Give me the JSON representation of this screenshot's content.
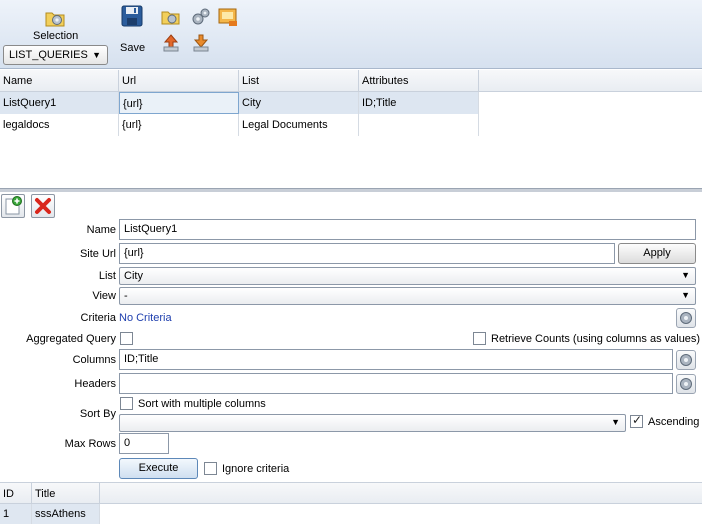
{
  "toolbar": {
    "selection_label": "Selection",
    "selection_value": "LIST_QUERIES",
    "save_label": "Save",
    "icons": [
      "settings-folder-icon",
      "save-icon",
      "folder-gear-icon",
      "gears-icon",
      "image-export-icon",
      "upload-icon",
      "download-icon"
    ]
  },
  "queries_grid": {
    "columns": [
      "Name",
      "Url",
      "List",
      "Attributes"
    ],
    "rows": [
      {
        "name": "ListQuery1",
        "url": "{url}",
        "list": "City",
        "attributes": "ID;Title"
      },
      {
        "name": "legaldocs",
        "url": "{url}",
        "list": "Legal Documents",
        "attributes": ""
      }
    ]
  },
  "form": {
    "name_label": "Name",
    "name_value": "ListQuery1",
    "site_url_label": "Site Url",
    "site_url_value": "{url}",
    "apply_label": "Apply",
    "list_label": "List",
    "list_value": "City",
    "view_label": "View",
    "view_value": "-",
    "criteria_label": "Criteria",
    "criteria_value": "No Criteria",
    "aggregated_label": "Aggregated Query",
    "aggregated_checked": false,
    "retrieve_counts_label": "Retrieve Counts (using columns as values)",
    "retrieve_counts_checked": false,
    "columns_label": "Columns",
    "columns_value": "ID;Title",
    "headers_label": "Headers",
    "headers_value": "",
    "sort_by_label": "Sort By",
    "sort_multiple_label": "Sort with multiple columns",
    "sort_multiple_checked": false,
    "sort_value": "",
    "ascending_label": "Ascending",
    "ascending_checked": true,
    "max_rows_label": "Max Rows",
    "max_rows_value": "0",
    "execute_label": "Execute",
    "ignore_criteria_label": "Ignore criteria",
    "ignore_criteria_checked": false
  },
  "results_grid": {
    "columns": [
      "ID",
      "Title"
    ],
    "rows": [
      {
        "id": "1",
        "title": "sssAthens"
      }
    ]
  },
  "colors": {
    "toolbar_bg": "#dbe5f1",
    "selection_highlight": "#dde6f1",
    "link": "#1f3fae",
    "delete_red": "#d9261c",
    "add_green": "#3aa63a"
  }
}
